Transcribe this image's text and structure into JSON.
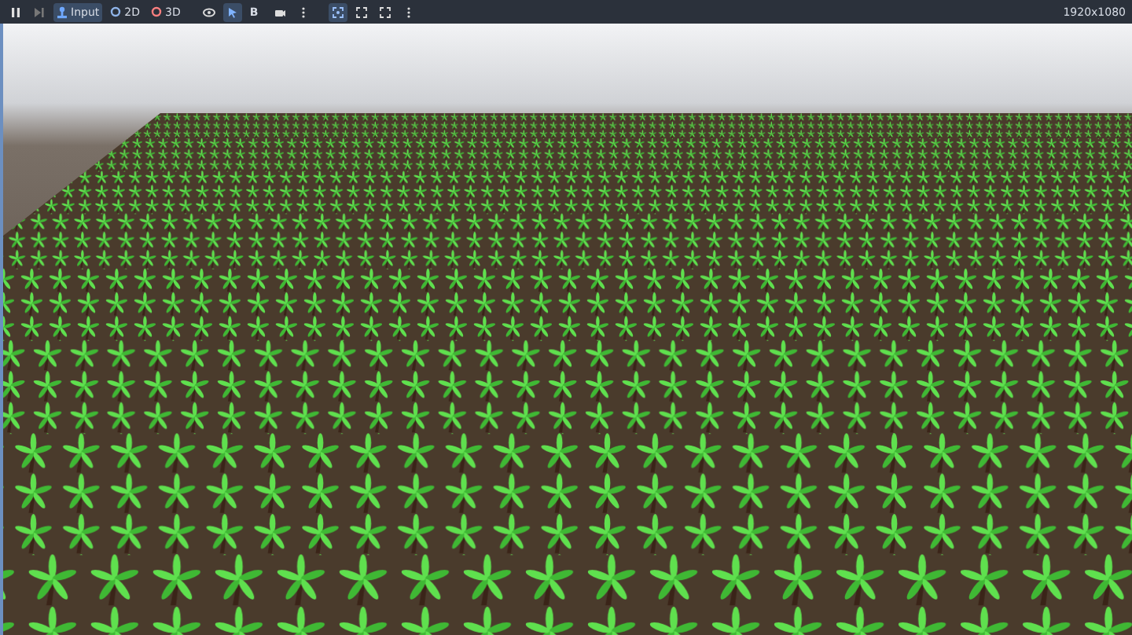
{
  "toolbar": [
    {
      "kind": "pause",
      "selected": false
    },
    {
      "kind": "step",
      "selected": false
    },
    {
      "kind": "toggle",
      "label": "Input",
      "selected": true,
      "color": "#6fa8ff"
    },
    {
      "kind": "toggle",
      "label": "2D",
      "selected": false,
      "color": "#8fb4e8"
    },
    {
      "kind": "toggle",
      "label": "3D",
      "selected": false,
      "color": "#fc7f7f"
    },
    {
      "kind": "eye",
      "selected": false
    },
    {
      "kind": "pointer",
      "selected": true
    },
    {
      "kind": "letter",
      "label": "B",
      "selected": false
    },
    {
      "kind": "camera",
      "selected": false
    },
    {
      "kind": "more",
      "selected": false
    },
    {
      "kind": "frame",
      "selected": true
    },
    {
      "kind": "expand",
      "selected": false
    },
    {
      "kind": "expand",
      "selected": false
    },
    {
      "kind": "more",
      "selected": false
    }
  ],
  "resolution": "1920x1080"
}
